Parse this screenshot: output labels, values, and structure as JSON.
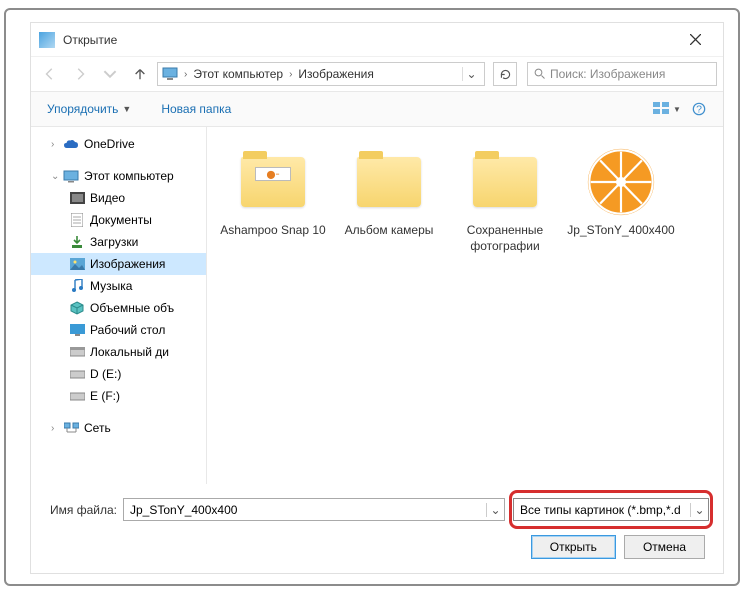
{
  "window": {
    "title": "Открытие"
  },
  "nav": {
    "breadcrumb": {
      "root": "Этот компьютер",
      "current": "Изображения"
    },
    "search_placeholder": "Поиск: Изображения"
  },
  "toolbar": {
    "organize": "Упорядочить",
    "new_folder": "Новая папка"
  },
  "sidebar": {
    "onedrive": "OneDrive",
    "this_pc": "Этот компьютер",
    "children": {
      "videos": "Видео",
      "documents": "Документы",
      "downloads": "Загрузки",
      "pictures": "Изображения",
      "music": "Музыка",
      "objects3d": "Объемные объ",
      "desktop": "Рабочий стол",
      "localdisk": "Локальный ди",
      "d": "D (E:)",
      "e": "E (F:)"
    },
    "network": "Сеть"
  },
  "files": [
    {
      "name": "Ashampoo Snap 10",
      "type": "folder-badge"
    },
    {
      "name": "Альбом камеры",
      "type": "folder"
    },
    {
      "name": "Сохраненные фотографии",
      "type": "folder"
    },
    {
      "name": "Jp_STonY_400x400",
      "type": "image-orange"
    }
  ],
  "footer": {
    "filename_label": "Имя файла:",
    "filename_value": "Jp_STonY_400x400",
    "filter": "Все типы картинок (*.bmp,*.d",
    "open": "Открыть",
    "cancel": "Отмена"
  }
}
